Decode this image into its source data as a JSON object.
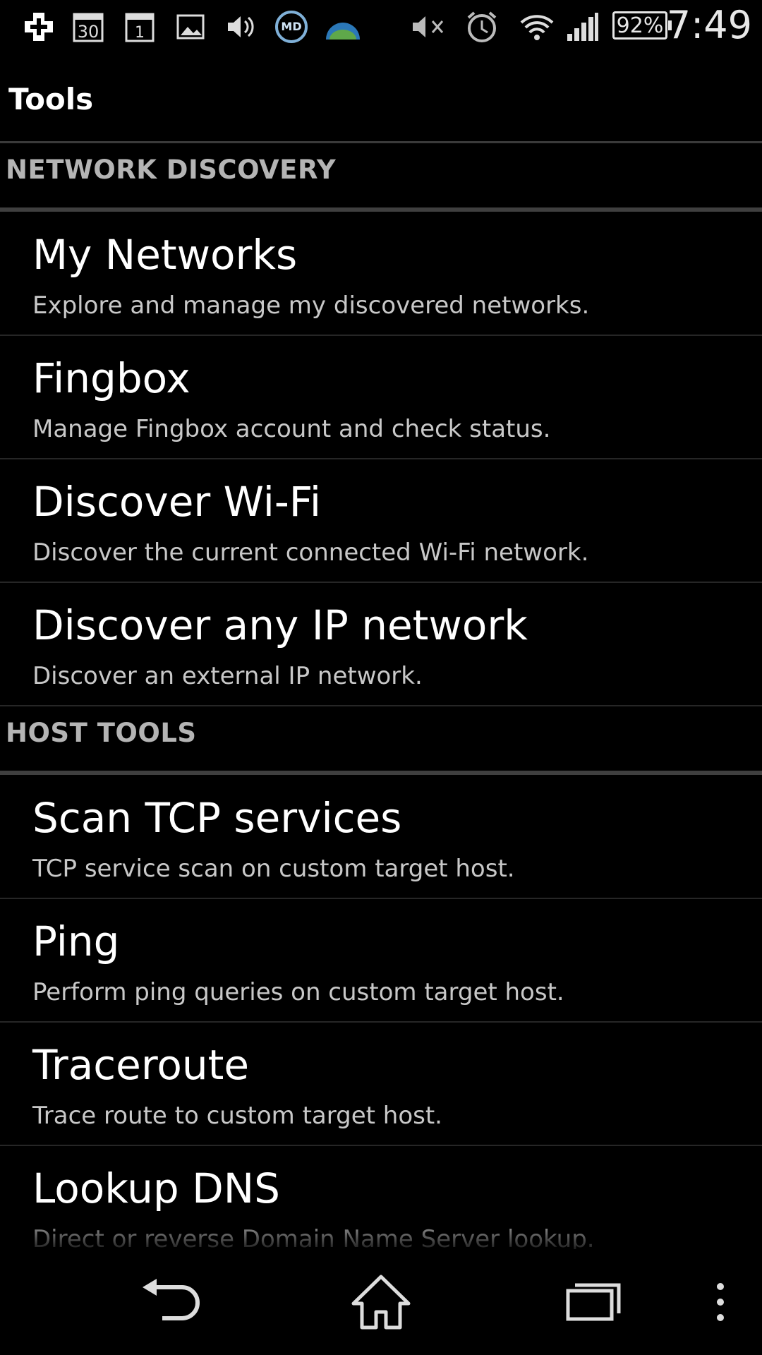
{
  "status_bar": {
    "time": "7:49",
    "battery": "92%",
    "icons": [
      "plus-notification-icon",
      "calendar-30-icon",
      "calendar-1-icon",
      "image-icon",
      "volume-icon",
      "md-app-icon",
      "globe-app-icon",
      "mute-icon",
      "alarm-icon",
      "wifi-icon",
      "signal-icon",
      "battery-icon"
    ]
  },
  "action_bar": {
    "title": "Tools"
  },
  "sections": [
    {
      "label": "NETWORK DISCOVERY",
      "items": [
        {
          "title": "My Networks",
          "subtitle": "Explore and manage my discovered networks."
        },
        {
          "title": "Fingbox",
          "subtitle": "Manage Fingbox account and check status."
        },
        {
          "title": "Discover Wi-Fi",
          "subtitle": "Discover the current connected Wi-Fi network."
        },
        {
          "title": "Discover any IP network",
          "subtitle": "Discover an external IP network."
        }
      ]
    },
    {
      "label": "HOST TOOLS",
      "items": [
        {
          "title": "Scan TCP services",
          "subtitle": "TCP service scan on custom target host."
        },
        {
          "title": "Ping",
          "subtitle": "Perform ping queries on custom target host."
        },
        {
          "title": "Traceroute",
          "subtitle": "Trace route to custom target host."
        },
        {
          "title": "Lookup DNS",
          "subtitle": "Direct or reverse Domain Name Server lookup."
        }
      ]
    }
  ],
  "nav_bar": {
    "buttons": [
      "back-icon",
      "home-icon",
      "recent-apps-icon",
      "overflow-menu-icon"
    ]
  },
  "colors": {
    "background": "#000000",
    "section_label": "#b4b4b4",
    "divider": "#3f3f3f"
  }
}
